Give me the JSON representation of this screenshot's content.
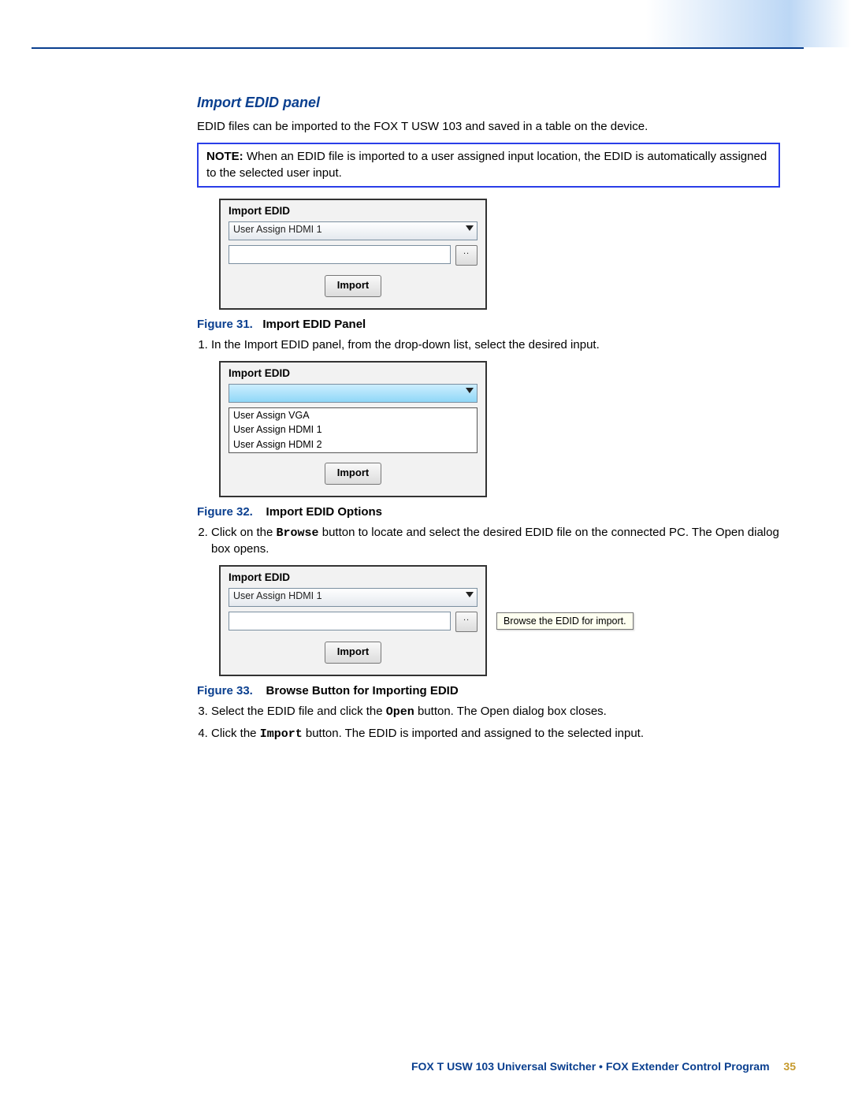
{
  "section_title": "Import EDID panel",
  "intro_text": "EDID files can be imported to the FOX T USW 103 and saved in a table on the device.",
  "note": {
    "label": "NOTE:",
    "text": "When an EDID file is imported to a user assigned input location, the EDID is automatically assigned to the selected user input."
  },
  "panel_title": "Import EDID",
  "dropdown_selected": "User Assign HDMI 1",
  "dropdown_options": [
    "User Assign VGA",
    "User Assign HDMI 1",
    "User Assign HDMI 2"
  ],
  "browse_dots": "..",
  "import_label": "Import",
  "tooltip_text": "Browse the EDID for import.",
  "fig31": {
    "label": "Figure 31.",
    "caption": "Import EDID Panel"
  },
  "fig32": {
    "label": "Figure 32.",
    "caption": "Import EDID Options"
  },
  "fig33": {
    "label": "Figure 33.",
    "caption": "Browse Button for Importing EDID"
  },
  "steps": {
    "s1": "In the Import EDID panel, from the drop-down list, select the desired input.",
    "s2a": "Click on the ",
    "s2_mono": "Browse",
    "s2b": " button to locate and select the desired EDID file on the connected PC. The Open dialog box opens.",
    "s3a": "Select the EDID file and click the ",
    "s3_mono": "Open",
    "s3b": " button. The Open dialog box closes.",
    "s4a": "Click the ",
    "s4_mono": "Import",
    "s4b": " button. The EDID is imported and assigned to the selected input."
  },
  "footer": {
    "text": "FOX T USW 103 Universal Switcher • FOX Extender Control Program",
    "page": "35"
  }
}
